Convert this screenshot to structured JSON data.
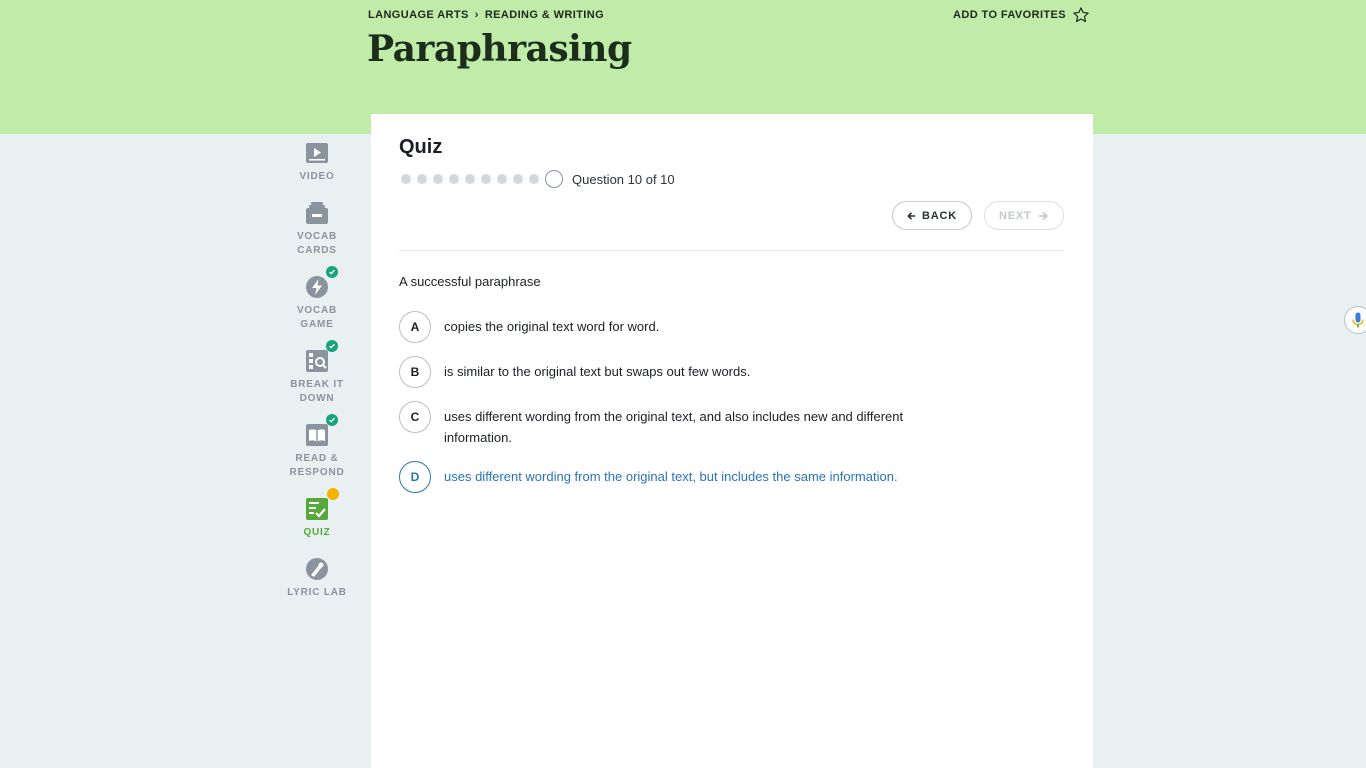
{
  "breadcrumb": {
    "items": [
      "LANGUAGE ARTS",
      "READING & WRITING"
    ]
  },
  "favorites_label": "ADD TO FAVORITES",
  "page_title": "Paraphrasing",
  "sidebar": {
    "items": [
      {
        "label": "VIDEO",
        "icon": "video-icon",
        "status": "none"
      },
      {
        "label": "VOCAB CARDS",
        "icon": "vocab-cards-icon",
        "status": "none"
      },
      {
        "label": "VOCAB GAME",
        "icon": "lightning-icon",
        "status": "complete"
      },
      {
        "label": "BREAK IT DOWN",
        "icon": "break-it-down-icon",
        "status": "complete"
      },
      {
        "label": "READ & RESPOND",
        "icon": "book-icon",
        "status": "complete"
      },
      {
        "label": "QUIZ",
        "icon": "quiz-icon",
        "status": "in-progress"
      },
      {
        "label": "LYRIC LAB",
        "icon": "lyric-lab-icon",
        "status": "none"
      }
    ]
  },
  "quiz": {
    "title": "Quiz",
    "progress": {
      "current": 10,
      "total": 10
    },
    "question_count_text": "Question 10 of 10",
    "back_label": "BACK",
    "next_label": "NEXT",
    "question": "A successful paraphrase",
    "answers": [
      {
        "letter": "A",
        "text": "copies the original text word for word.",
        "selected": false
      },
      {
        "letter": "B",
        "text": "is similar to the original text but swaps out few words.",
        "selected": false
      },
      {
        "letter": "C",
        "text": "uses different wording from the original text, and also includes new and different information.",
        "selected": false
      },
      {
        "letter": "D",
        "text": "uses different wording from the original text, but includes the same information.",
        "selected": true
      }
    ]
  },
  "colors": {
    "hero_bg": "#c1eba8",
    "page_bg": "#e8f0f1",
    "active_green": "#57a83a",
    "selected_blue": "#2a73b8",
    "check_green": "#1aa37a",
    "badge_yellow": "#f5b300"
  }
}
